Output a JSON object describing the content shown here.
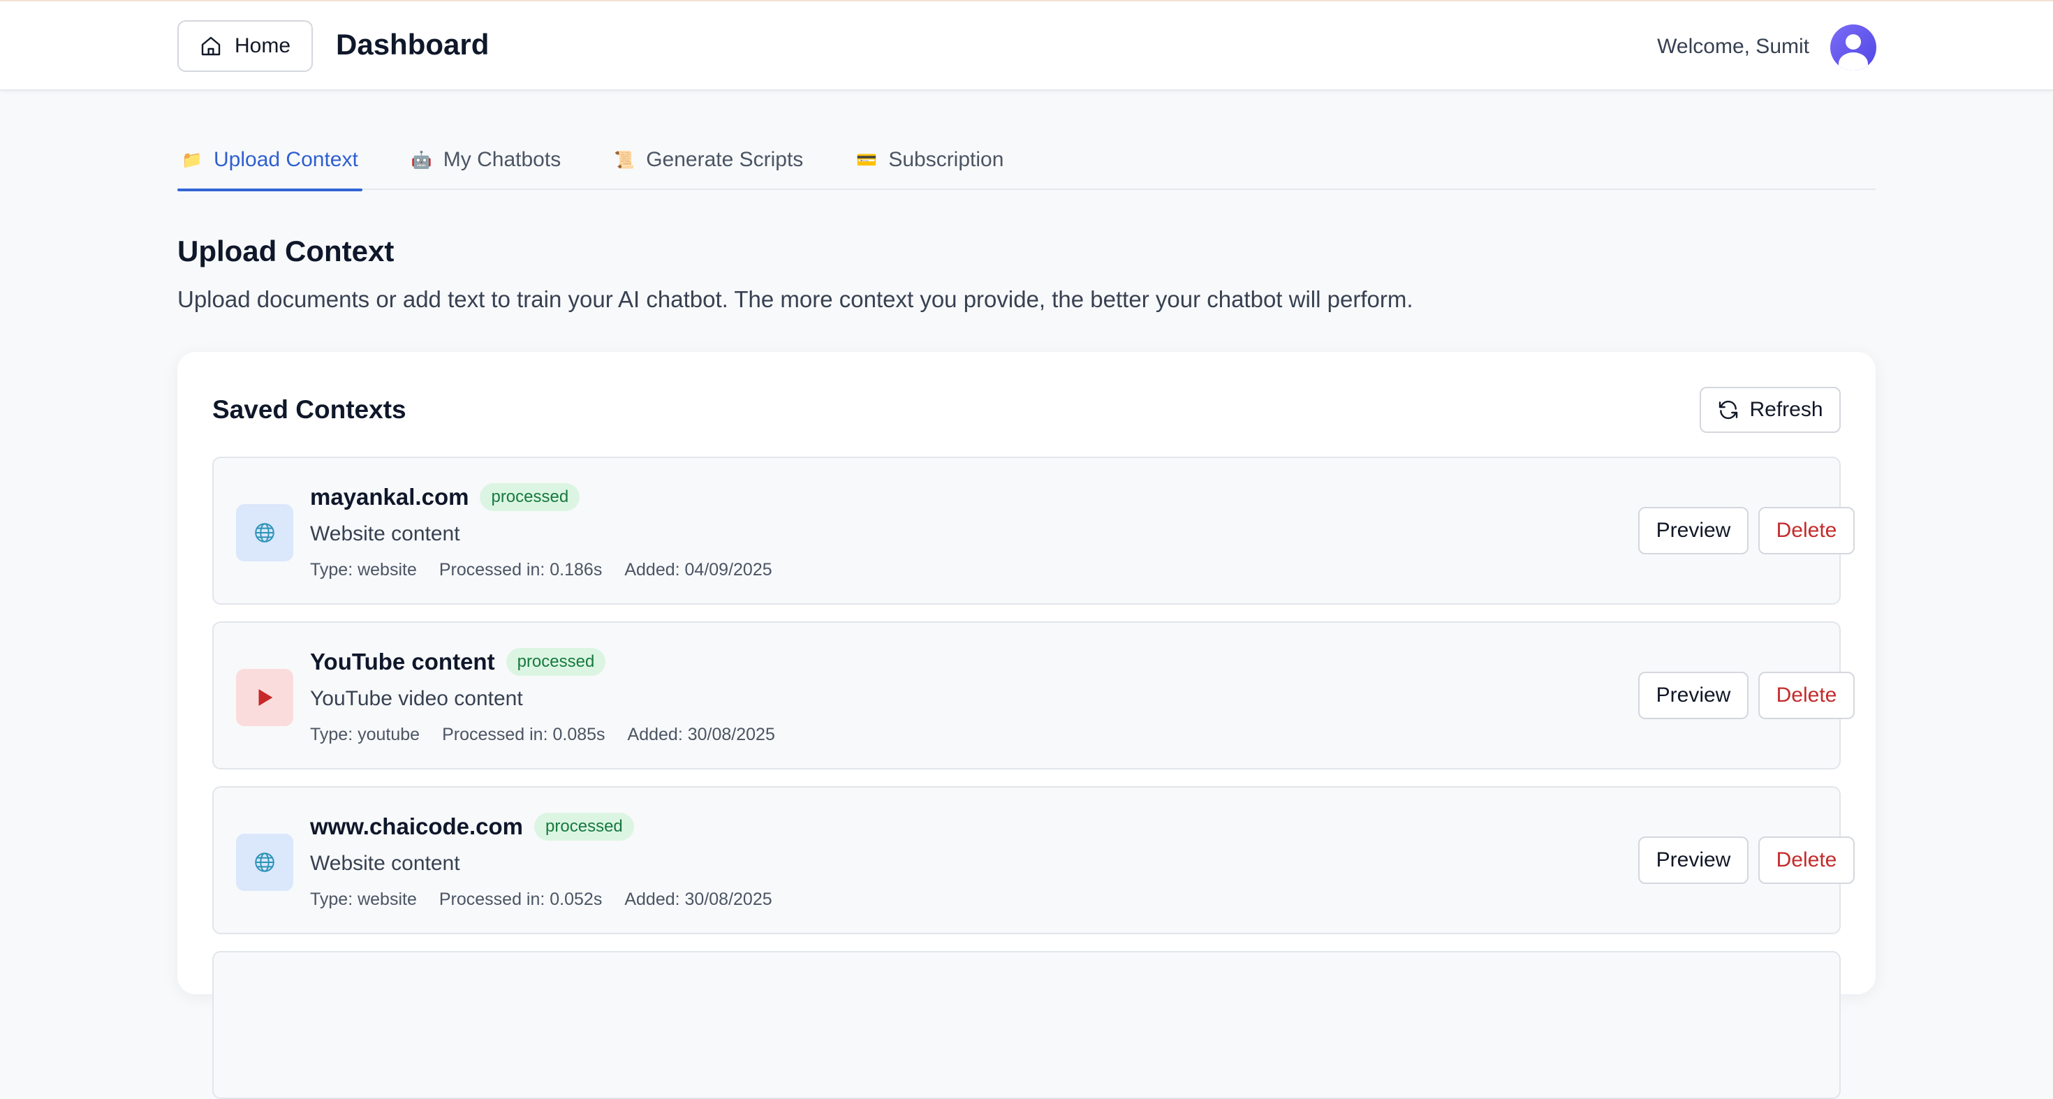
{
  "header": {
    "home_label": "Home",
    "title": "Dashboard",
    "welcome": "Welcome, Sumit"
  },
  "tabs": [
    {
      "emoji": "📁",
      "label": "Upload Context",
      "active": true
    },
    {
      "emoji": "🤖",
      "label": "My Chatbots",
      "active": false
    },
    {
      "emoji": "📜",
      "label": "Generate Scripts",
      "active": false
    },
    {
      "emoji": "💳",
      "label": "Subscription",
      "active": false
    }
  ],
  "section": {
    "title": "Upload Context",
    "description": "Upload documents or add text to train your AI chatbot. The more context you provide, the better your chatbot will perform."
  },
  "saved": {
    "title": "Saved Contexts",
    "refresh_label": "Refresh",
    "preview_label": "Preview",
    "delete_label": "Delete",
    "items": [
      {
        "icon": "globe-icon",
        "name": "mayankal.com",
        "status": "processed",
        "description": "Website content",
        "type": "Type: website",
        "processed": "Processed in: 0.186s",
        "added": "Added: 04/09/2025"
      },
      {
        "icon": "play-icon",
        "name": "YouTube content",
        "status": "processed",
        "description": "YouTube video content",
        "type": "Type: youtube",
        "processed": "Processed in: 0.085s",
        "added": "Added: 30/08/2025"
      },
      {
        "icon": "globe-icon",
        "name": "www.chaicode.com",
        "status": "processed",
        "description": "Website content",
        "type": "Type: website",
        "processed": "Processed in: 0.052s",
        "added": "Added: 30/08/2025"
      }
    ]
  },
  "colors": {
    "accent": "#3366d6",
    "danger": "#c42b2b",
    "success_bg": "#dcf5e3",
    "success_text": "#167a3d"
  }
}
